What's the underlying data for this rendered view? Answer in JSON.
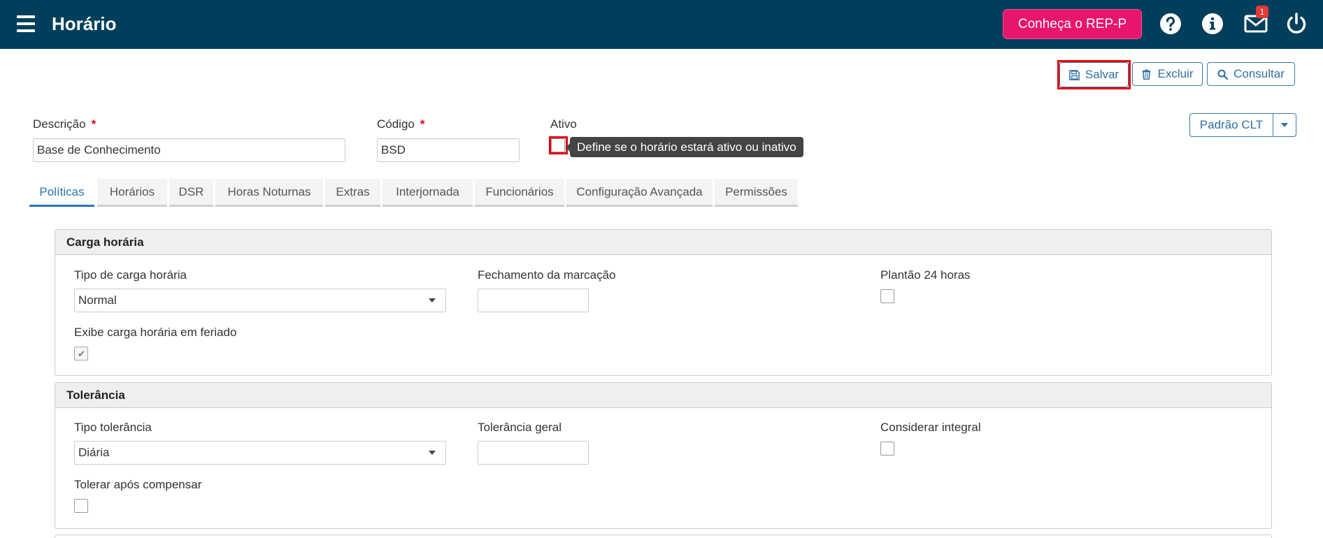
{
  "header": {
    "title": "Horário",
    "rep_button": "Conheça o REP-P",
    "notification_count": "1"
  },
  "toolbar": {
    "save": "Salvar",
    "delete": "Excluir",
    "search": "Consultar",
    "clt": "Padrão CLT"
  },
  "form": {
    "descricao_label": "Descrição",
    "descricao_value": "Base de Conhecimento",
    "codigo_label": "Código",
    "codigo_value": "BSD",
    "required_mark": "*",
    "ativo_label": "Ativo",
    "ativo_tooltip": "Define se o horário estará ativo ou inativo"
  },
  "tabs": [
    "Políticas",
    "Horários",
    "DSR",
    "Horas Noturnas",
    "Extras",
    "Interjornada",
    "Funcionários",
    "Configuração Avançada",
    "Permissões"
  ],
  "carga": {
    "title": "Carga horária",
    "tipo_label": "Tipo de carga horária",
    "tipo_value": "Normal",
    "fechamento_label": "Fechamento da marcação",
    "fechamento_value": "",
    "plantao_label": "Plantão 24 horas",
    "exibe_label": "Exibe carga horária em feriado"
  },
  "tolerancia": {
    "title": "Tolerância",
    "tipo_label": "Tipo tolerância",
    "tipo_value": "Diária",
    "geral_label": "Tolerância geral",
    "geral_value": "",
    "integral_label": "Considerar integral",
    "compensar_label": "Tolerar após compensar"
  },
  "colors": {
    "topbar": "#003f5c",
    "accent_pink": "#e8156d",
    "link_blue": "#2f6fa3",
    "highlight_red": "#e3000f"
  }
}
